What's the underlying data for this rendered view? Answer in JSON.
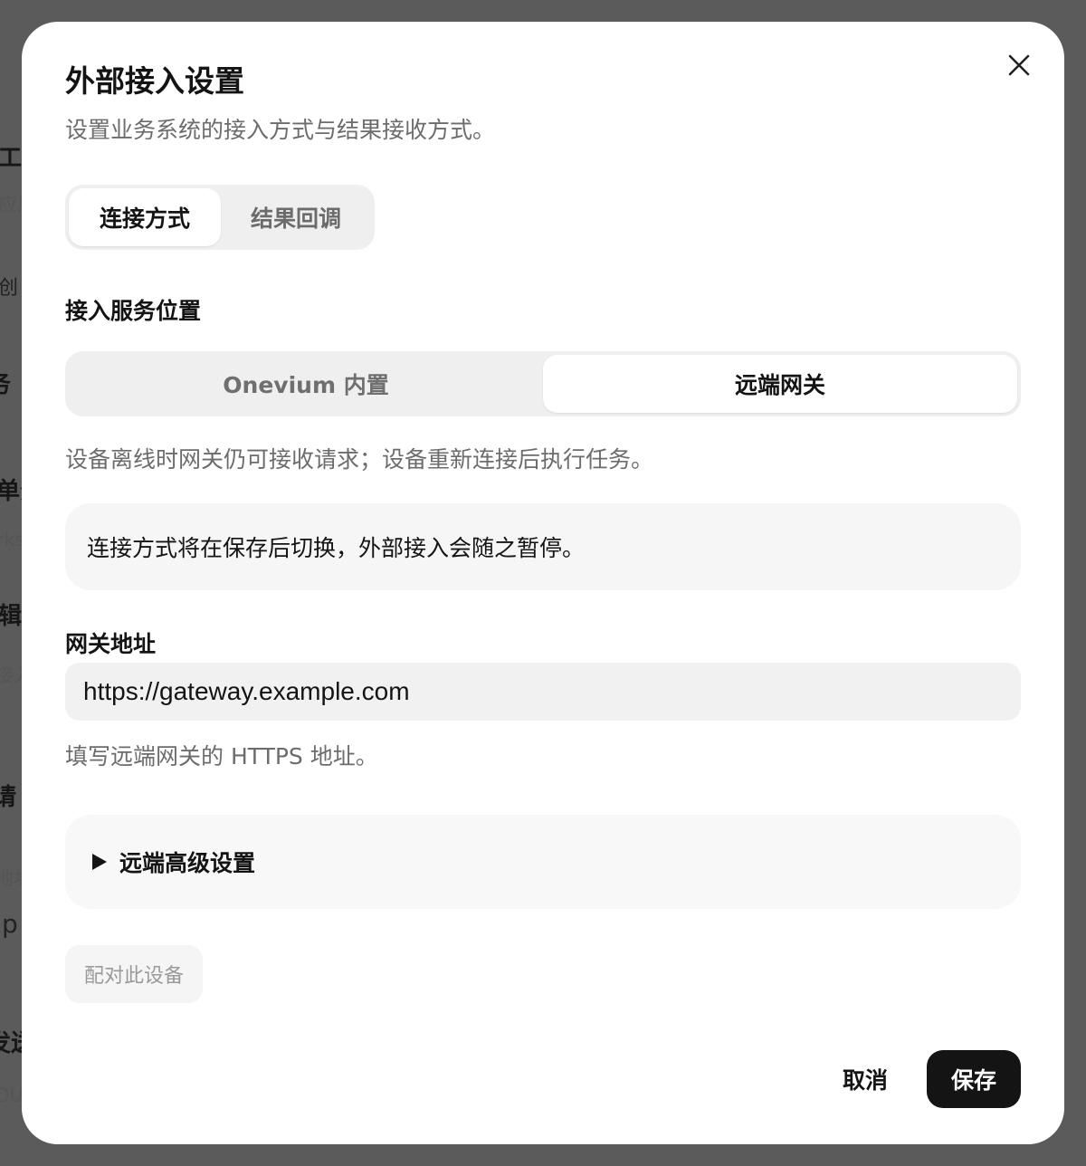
{
  "background": {
    "fragments": [
      "工",
      "应用",
      "创",
      "务",
      "单分",
      "rks",
      "辑",
      "接入",
      "请",
      "地址",
      "p",
      "发送",
      "OU"
    ]
  },
  "dialog": {
    "title": "外部接入设置",
    "subtitle": "设置业务系统的接入方式与结果接收方式。",
    "close_icon": "close-icon",
    "tabs": [
      {
        "label": "连接方式",
        "active": true
      },
      {
        "label": "结果回调",
        "active": false
      }
    ],
    "service_location": {
      "label": "接入服务位置",
      "options": [
        {
          "label": "Onevium 内置",
          "active": false
        },
        {
          "label": "远端网关",
          "active": true
        }
      ],
      "helper": "设备离线时网关仍可接收请求；设备重新连接后执行任务。"
    },
    "notice": "连接方式将在保存后切换，外部接入会随之暂停。",
    "gateway": {
      "label": "网关地址",
      "value": "https://gateway.example.com",
      "helper": "填写远端网关的 HTTPS 地址。"
    },
    "advanced": {
      "label": "远端高级设置",
      "icon": "triangle-right-icon"
    },
    "pair_button": "配对此设备",
    "cancel_button": "取消",
    "save_button": "保存"
  },
  "colors": {
    "overlay": "#5b5b5b",
    "primary": "#141414",
    "muted_text": "#6c6c6c",
    "segment_bg": "#efefef"
  }
}
